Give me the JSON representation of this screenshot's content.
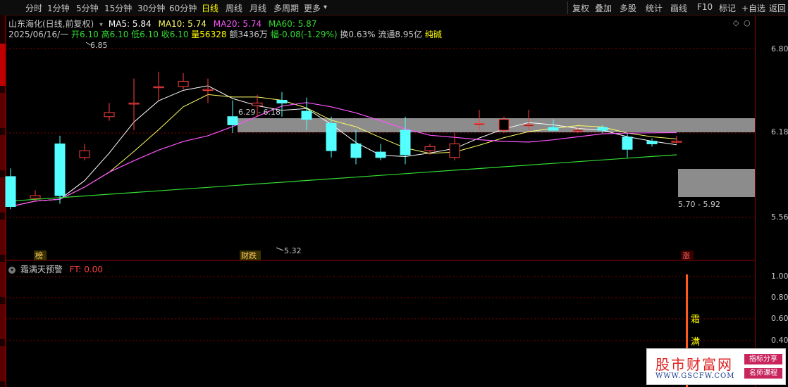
{
  "toolbar": {
    "periods": [
      "分时",
      "1分钟",
      "5分钟",
      "15分钟",
      "30分钟",
      "60分钟",
      "日线",
      "周线",
      "月线",
      "多周期",
      "更多"
    ],
    "active_period": "日线",
    "actions": [
      "复权",
      "叠加",
      "多股",
      "统计",
      "画线",
      "F10",
      "标记",
      "+自选",
      "返回"
    ]
  },
  "header": {
    "stock": "山东海化(日线,前复权)",
    "ma5": "MA5: 5.84",
    "ma10": "MA10: 5.74",
    "ma20": "MA20: 5.74",
    "ma60": "MA60: 5.87",
    "date": "2025/06/16/一",
    "open": "开6.10",
    "high": "高6.10",
    "low": "低6.10",
    "close": "收6.10",
    "volume": "量56328",
    "amount": "额3436万",
    "change": "幅-0.08(-1.29%)",
    "turnover": "换0.63%",
    "float_cap": "流通8.95亿",
    "concept": "纯碱"
  },
  "colors": {
    "up": "#ff4040",
    "down": "#54ffff",
    "ma5": "#ffffff",
    "ma10": "#ffff66",
    "ma20": "#ff55ff",
    "ma60": "#33dd33",
    "grid": "#8b0000",
    "band": "#8c8c8c"
  },
  "chart_data": {
    "type": "candlestick",
    "y_ticks": [
      "6.80",
      "6.18",
      "5.56"
    ],
    "candles": [
      {
        "o": 5.86,
        "c": 5.64,
        "h": 5.92,
        "l": 5.62
      },
      {
        "o": 5.7,
        "c": 5.72,
        "h": 5.76,
        "l": 5.68
      },
      {
        "o": 6.1,
        "c": 5.72,
        "h": 6.16,
        "l": 5.66
      },
      {
        "o": 6.0,
        "c": 6.05,
        "h": 6.1,
        "l": 5.98
      },
      {
        "o": 6.3,
        "c": 6.33,
        "h": 6.4,
        "l": 6.27
      },
      {
        "o": 6.4,
        "c": 6.4,
        "h": 6.58,
        "l": 6.2
      },
      {
        "o": 6.52,
        "c": 6.52,
        "h": 6.63,
        "l": 6.42
      },
      {
        "o": 6.52,
        "c": 6.56,
        "h": 6.62,
        "l": 6.5
      },
      {
        "o": 6.5,
        "c": 6.5,
        "h": 6.58,
        "l": 6.4
      },
      {
        "o": 6.3,
        "c": 6.24,
        "h": 6.42,
        "l": 6.18
      },
      {
        "o": 6.38,
        "c": 6.4,
        "h": 6.46,
        "l": 6.3
      },
      {
        "o": 6.42,
        "c": 6.4,
        "h": 6.48,
        "l": 6.3
      },
      {
        "o": 6.34,
        "c": 6.28,
        "h": 6.44,
        "l": 6.2
      },
      {
        "o": 6.25,
        "c": 6.05,
        "h": 6.3,
        "l": 6.0
      },
      {
        "o": 6.1,
        "c": 6.0,
        "h": 6.2,
        "l": 5.95
      },
      {
        "o": 6.04,
        "c": 6.0,
        "h": 6.1,
        "l": 5.98
      },
      {
        "o": 6.2,
        "c": 6.02,
        "h": 6.3,
        "l": 5.95
      },
      {
        "o": 6.05,
        "c": 6.08,
        "h": 6.1,
        "l": 6.02
      },
      {
        "o": 6.0,
        "c": 6.1,
        "h": 6.18,
        "l": 5.98
      },
      {
        "o": 6.25,
        "c": 6.25,
        "h": 6.35,
        "l": 6.2
      },
      {
        "o": 6.2,
        "c": 6.28,
        "h": 6.3,
        "l": 6.18
      },
      {
        "o": 6.24,
        "c": 6.24,
        "h": 6.35,
        "l": 6.2
      },
      {
        "o": 6.22,
        "c": 6.2,
        "h": 6.28,
        "l": 6.2
      },
      {
        "o": 6.2,
        "c": 6.2,
        "h": 6.22,
        "l": 6.18
      },
      {
        "o": 6.22,
        "c": 6.2,
        "h": 6.24,
        "l": 6.18
      },
      {
        "o": 6.15,
        "c": 6.06,
        "h": 6.18,
        "l": 6.0
      },
      {
        "o": 6.12,
        "c": 6.1,
        "h": 6.14,
        "l": 6.08
      },
      {
        "o": 6.12,
        "c": 6.12,
        "h": 6.16,
        "l": 6.1
      }
    ],
    "annotations": [
      "6.85",
      "6.29 - 6.18",
      "5.32",
      "5.70 - 5.92"
    ],
    "markers": [
      "榜",
      "财跌",
      "涨"
    ]
  },
  "indicator": {
    "name": "霜满天预警",
    "ft": "FT: 0.00",
    "ticks": [
      "1.00",
      "0.80",
      "0.60",
      "0.40"
    ],
    "side_labels": [
      "霜",
      "满"
    ]
  },
  "watermark": {
    "name": "股市财富网",
    "url": "WWW.GSCFW.COM",
    "tag1": "指标分享",
    "tag2": "名师课程"
  }
}
